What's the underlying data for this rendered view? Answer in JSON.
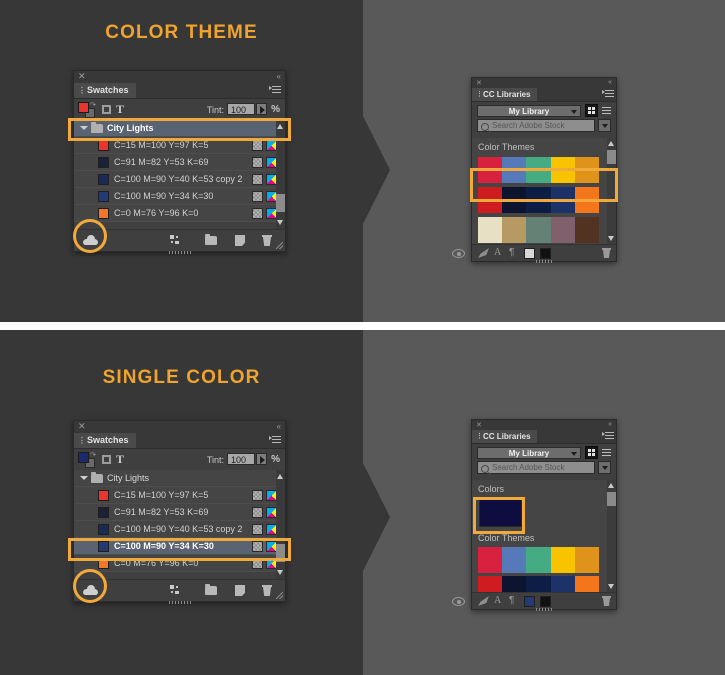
{
  "theme_colors": {
    "accent_orange": "#f2a93b",
    "bg_dark": "#373737",
    "bg_light": "#595959",
    "panel_bg": "#3f3f3f",
    "divider_white": "#ffffff"
  },
  "sections": [
    {
      "heading": "COLOR THEME",
      "swatches_panel": {
        "tab_label": "Swatches",
        "close_icon": "close-icon",
        "collapse_icon": "double-chevron-left-icon",
        "menu_icon": "panel-menu-icon",
        "fill_color": "#e8362e",
        "stroke_color": "#6a6a6a",
        "tint_label": "Tint:",
        "tint_value": "100",
        "tint_unit": "%",
        "group": {
          "name": "City Lights",
          "expanded": true,
          "selected": true
        },
        "rows": [
          {
            "name": "C=15 M=100 Y=97 K=5",
            "color": "#e8362e",
            "selected": false
          },
          {
            "name": "C=91 M=82 Y=53 K=69",
            "color": "#1c2235",
            "selected": false
          },
          {
            "name": "C=100 M=90 Y=40 K=53 copy 2",
            "color": "#1b2a55",
            "selected": false
          },
          {
            "name": "C=100 M=90 Y=34 K=30",
            "color": "#253a73",
            "selected": false
          },
          {
            "name": "C=0 M=76 Y=96 K=0",
            "color": "#f4762a",
            "selected": false
          }
        ],
        "footer_icons": [
          "cloud-icon",
          "new-color-group-icon",
          "folder-icon",
          "new-swatch-icon",
          "trash-icon"
        ]
      },
      "libraries_panel": {
        "tab_label": "CC Libraries",
        "library_name": "My Library",
        "search_placeholder": "Search Adobe Stock",
        "view_grid_icon": "grid-view-icon",
        "view_list_icon": "list-view-icon",
        "sections": [
          {
            "label": "Color Themes",
            "themes": [
              {
                "selected": false,
                "colors": [
                  "#d8213f",
                  "#5579b9",
                  "#45ab82",
                  "#f8c400",
                  "#e0931a"
                ]
              },
              {
                "selected": true,
                "colors": [
                  "#ce1c20",
                  "#0d1430",
                  "#0d1e46",
                  "#1d3268",
                  "#f4761a"
                ]
              },
              {
                "selected": false,
                "colors": [
                  "#e8e0c4",
                  "#b79a63",
                  "#648175",
                  "#80606c",
                  "#523221"
                ]
              }
            ]
          }
        ],
        "footer_icons": [
          "brush-icon",
          "character-style-icon",
          "paragraph-style-icon",
          "fill-color-icon",
          "stroke-color-icon",
          "eye-icon",
          "trash-icon"
        ],
        "footer_fill": "#d8d8d8",
        "footer_stroke": "#111111"
      }
    },
    {
      "heading": "SINGLE COLOR",
      "swatches_panel": {
        "tab_label": "Swatches",
        "close_icon": "close-icon",
        "collapse_icon": "double-chevron-left-icon",
        "menu_icon": "panel-menu-icon",
        "fill_color": "#1c2a6b",
        "stroke_color": "#6a6a6a",
        "tint_label": "Tint:",
        "tint_value": "100",
        "tint_unit": "%",
        "group": {
          "name": "City Lights",
          "expanded": true,
          "selected": false
        },
        "rows": [
          {
            "name": "C=15 M=100 Y=97 K=5",
            "color": "#e8362e",
            "selected": false
          },
          {
            "name": "C=91 M=82 Y=53 K=69",
            "color": "#1c2235",
            "selected": false
          },
          {
            "name": "C=100 M=90 Y=40 K=53 copy 2",
            "color": "#1b2a55",
            "selected": false
          },
          {
            "name": "C=100 M=90 Y=34 K=30",
            "color": "#253a73",
            "selected": true
          },
          {
            "name": "C=0 M=76 Y=96 K=0",
            "color": "#f4762a",
            "selected": false
          }
        ],
        "footer_icons": [
          "cloud-icon",
          "new-color-group-icon",
          "folder-icon",
          "new-swatch-icon",
          "trash-icon"
        ]
      },
      "libraries_panel": {
        "tab_label": "CC Libraries",
        "library_name": "My Library",
        "search_placeholder": "Search Adobe Stock",
        "view_grid_icon": "grid-view-icon",
        "view_list_icon": "list-view-icon",
        "colors_label": "Colors",
        "single_color": {
          "color": "#0d0d40",
          "selected": true
        },
        "sections": [
          {
            "label": "Color Themes",
            "themes": [
              {
                "selected": false,
                "colors": [
                  "#d8213f",
                  "#5579b9",
                  "#45ab82",
                  "#f8c400",
                  "#e0931a"
                ]
              },
              {
                "selected": false,
                "colors": [
                  "#ce1c20",
                  "#0d1430",
                  "#0d1e46",
                  "#1d3268",
                  "#f4761a"
                ]
              }
            ]
          }
        ],
        "footer_icons": [
          "brush-icon",
          "character-style-icon",
          "paragraph-style-icon",
          "fill-color-icon",
          "stroke-color-icon",
          "eye-icon",
          "trash-icon"
        ],
        "footer_fill": "#253a73",
        "footer_stroke": "#111111"
      }
    }
  ]
}
